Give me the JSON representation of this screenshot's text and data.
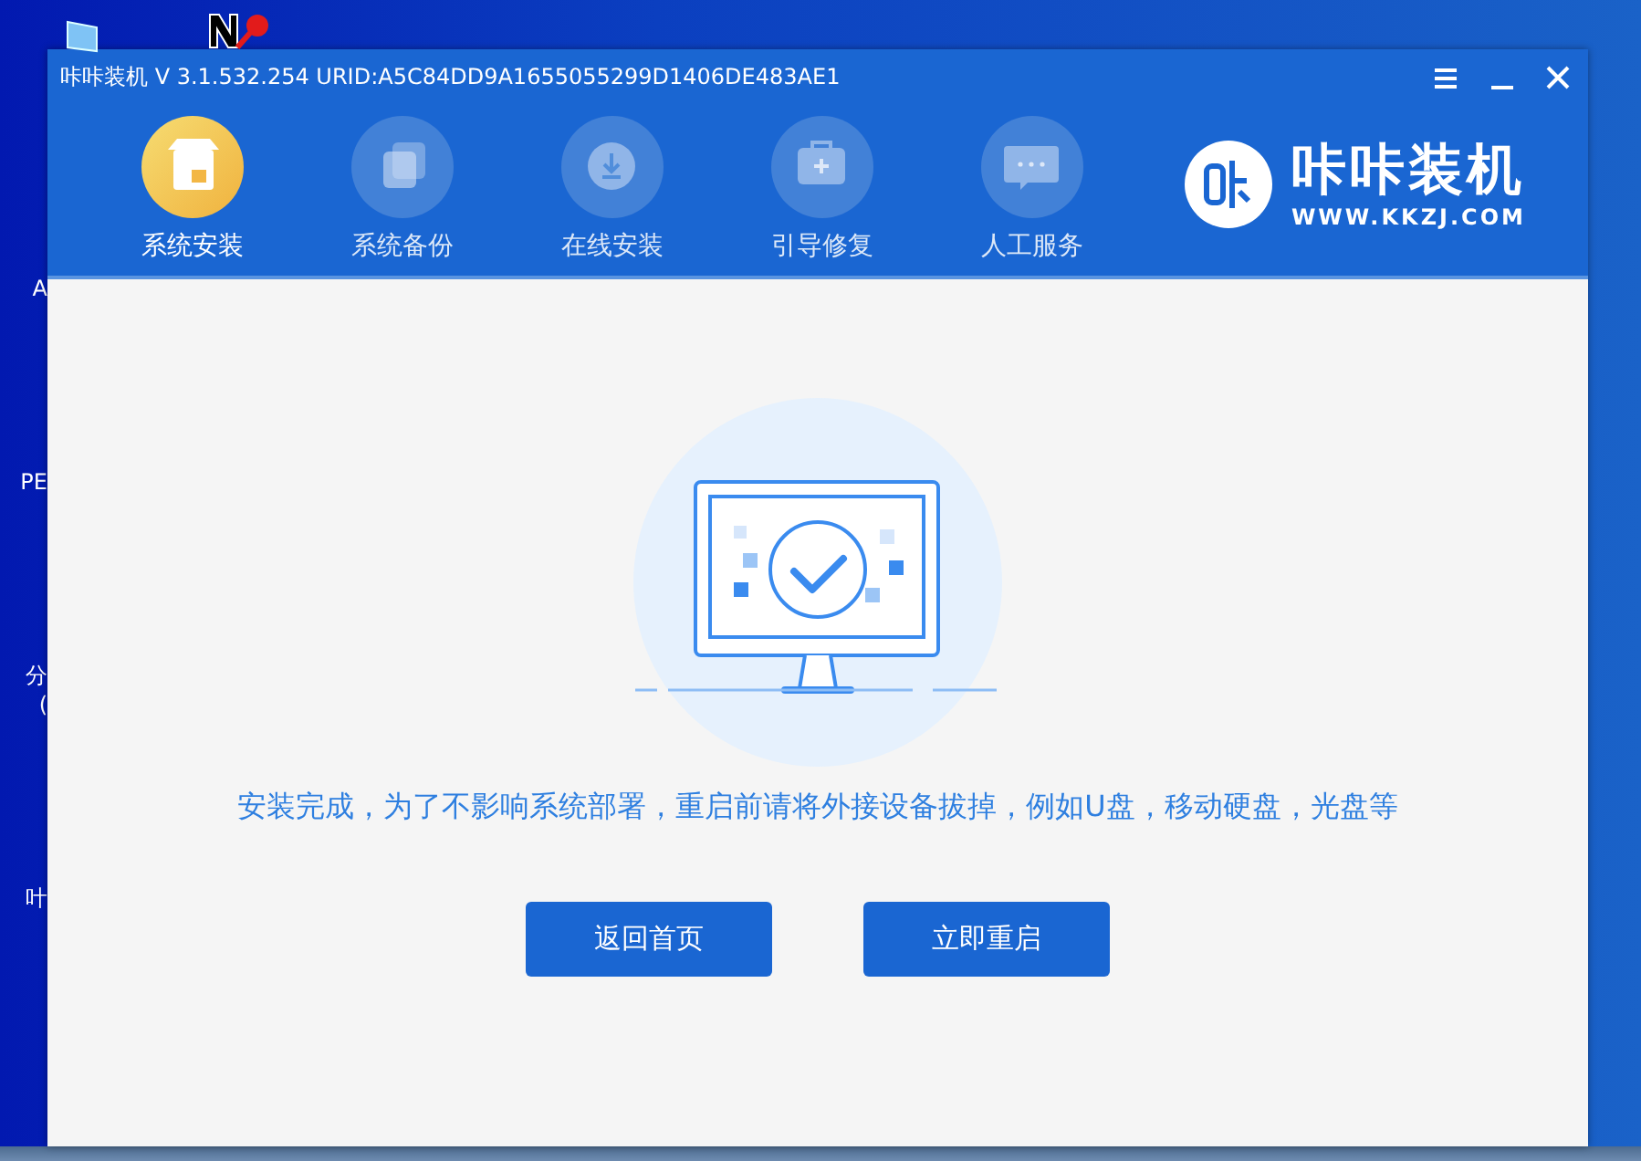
{
  "desktop": {
    "labels": [
      "A",
      "PE",
      "分",
      "(",
      "叶"
    ]
  },
  "window": {
    "title": "咔咔装机 V 3.1.532.254 URID:A5C84DD9A1655055299D1406DE483AE1"
  },
  "nav": [
    {
      "label": "系统安装",
      "selected": true,
      "kind": "install"
    },
    {
      "label": "系统备份",
      "selected": false,
      "kind": "backup"
    },
    {
      "label": "在线安装",
      "selected": false,
      "kind": "online"
    },
    {
      "label": "引导修复",
      "selected": false,
      "kind": "repair"
    },
    {
      "label": "人工服务",
      "selected": false,
      "kind": "service"
    }
  ],
  "logo": {
    "name": "咔咔装机",
    "url": "WWW.KKZJ.COM"
  },
  "message": "安装完成，为了不影响系统部署，重启前请将外接设备拔掉，例如U盘，移动硬盘，光盘等",
  "buttons": [
    "返回首页",
    "立即重启"
  ]
}
